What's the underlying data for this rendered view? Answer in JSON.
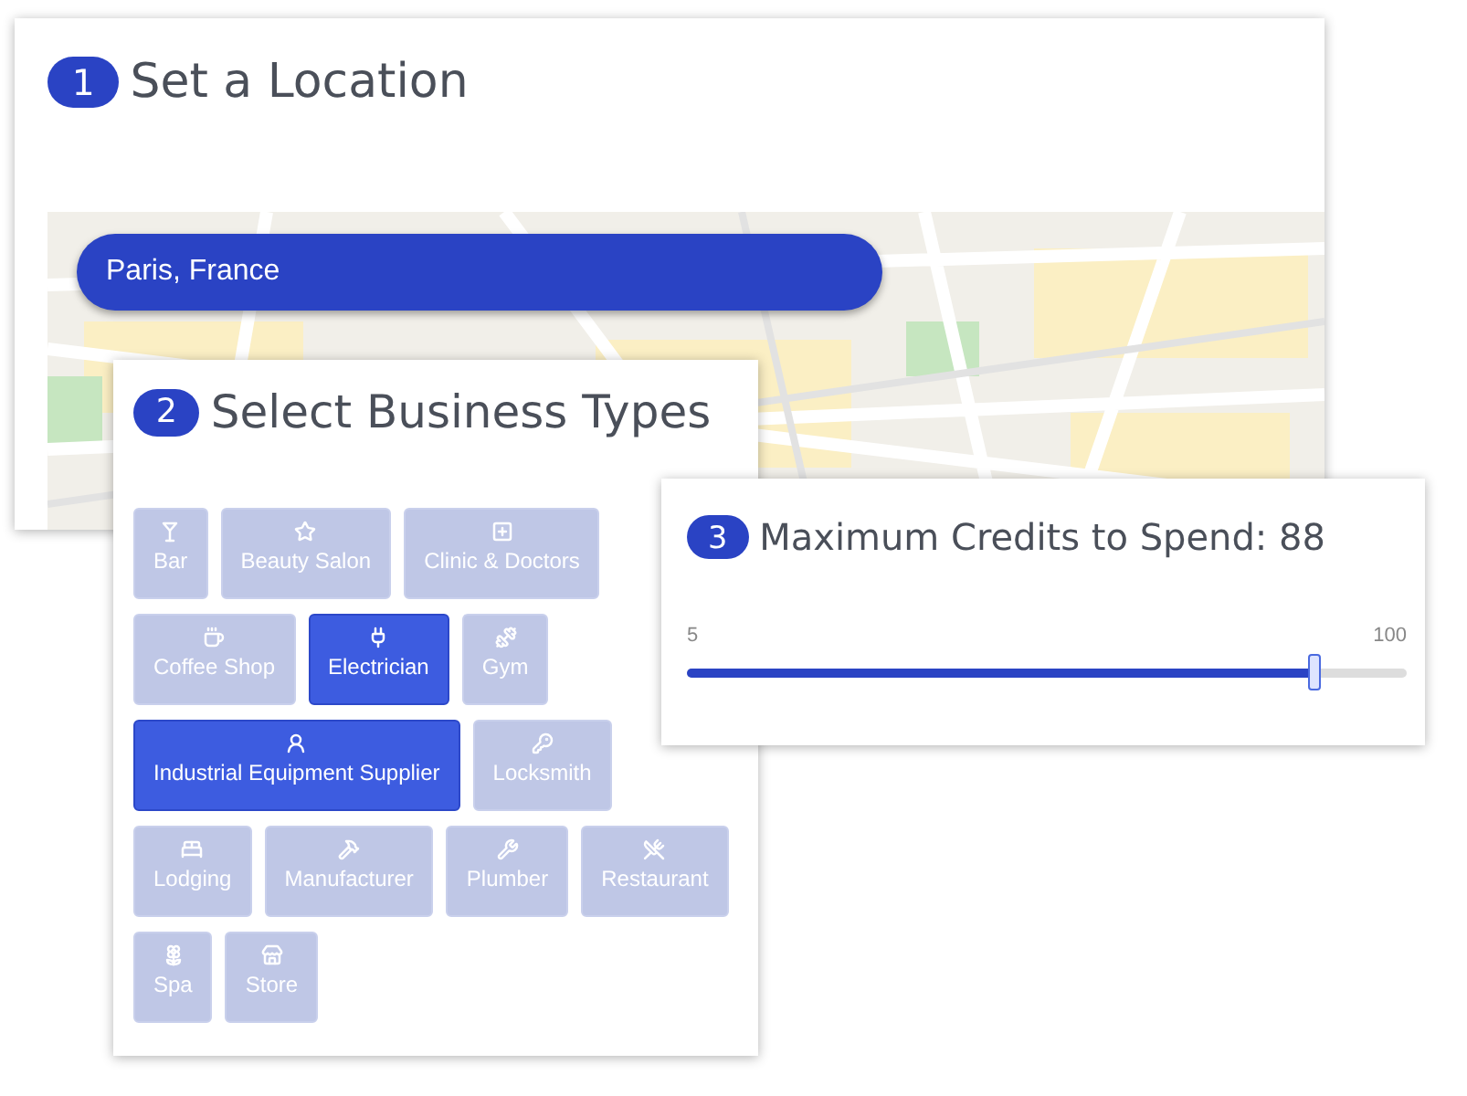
{
  "location_card": {
    "step": "1",
    "title": "Set a Location",
    "search": {
      "value": "Paris, France"
    }
  },
  "business_card": {
    "step": "2",
    "title": "Select Business Types",
    "types": [
      {
        "label": "Bar",
        "selected": false
      },
      {
        "label": "Beauty Salon",
        "selected": false
      },
      {
        "label": "Clinic & Doctors",
        "selected": false
      },
      {
        "label": "Coffee Shop",
        "selected": false
      },
      {
        "label": "Electrician",
        "selected": true
      },
      {
        "label": "Gym",
        "selected": false
      },
      {
        "label": "Industrial Equipment Supplier",
        "selected": true
      },
      {
        "label": "Locksmith",
        "selected": false
      },
      {
        "label": "Lodging",
        "selected": false
      },
      {
        "label": "Manufacturer",
        "selected": false
      },
      {
        "label": "Plumber",
        "selected": false
      },
      {
        "label": "Restaurant",
        "selected": false
      },
      {
        "label": "Spa",
        "selected": false
      },
      {
        "label": "Store",
        "selected": false
      }
    ]
  },
  "credits_card": {
    "step": "3",
    "title": "Maximum Credits to Spend: 88",
    "min": "5",
    "max": "100",
    "level": 0.87
  }
}
